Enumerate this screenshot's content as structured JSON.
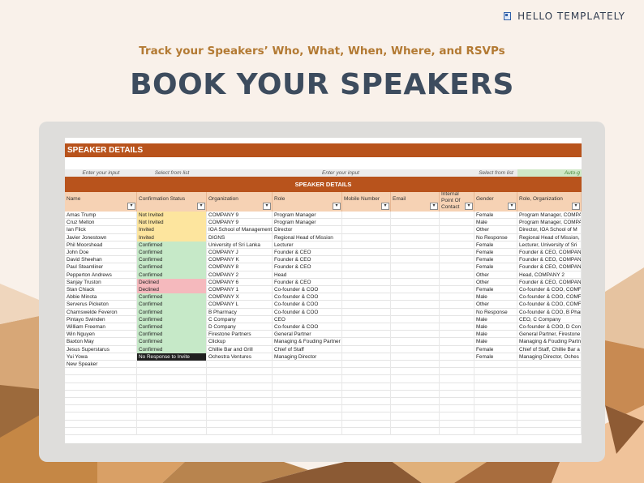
{
  "brand": {
    "name": "HELLO TEMPLATELY",
    "icon": "notebook-icon"
  },
  "tagline": "Track your Speakers’ Who, What, When, Where, and RSVPs",
  "headline": "BOOK YOUR SPEAKERS",
  "sheet": {
    "title": "SPEAKER DETAILS",
    "band_title": "SPEAKER DETAILS",
    "hints": {
      "name": "Enter your input",
      "status": "Select from list",
      "org_to_point": "Enter your input",
      "gender": "Select from list",
      "auto": "Auto-g"
    },
    "columns": [
      {
        "label": "Name"
      },
      {
        "label": "Confirmation Status"
      },
      {
        "label": "Organization"
      },
      {
        "label": "Role"
      },
      {
        "label": "Mobile Number"
      },
      {
        "label": "Email"
      },
      {
        "label": "Internal Point Of Contact"
      },
      {
        "label": "Gender"
      },
      {
        "label": "Role, Organization"
      }
    ],
    "dropdown_glyph": "▾",
    "rows": [
      {
        "name": "Amas Trump",
        "status": "Not Invited",
        "org": "COMPANY 9",
        "role": "Program Manager",
        "gender": "Female",
        "ro": "Program Manager, COMPA"
      },
      {
        "name": "Cruz Melton",
        "status": "Not Invited",
        "org": "COMPANY 9",
        "role": "Program Manager",
        "gender": "Male",
        "ro": "Program Manager, COMPA"
      },
      {
        "name": "Ian Flick",
        "status": "Invited",
        "org": "IOA School of Management",
        "role": "Director",
        "gender": "Other",
        "ro": "Director, IOA School of M"
      },
      {
        "name": "Javier Jonestown",
        "status": "Invited",
        "org": "DIGNS",
        "role": "Regional Head of Mission",
        "gender": "No Response",
        "ro": "Regional Head of Mission,"
      },
      {
        "name": "Phil Moorshead",
        "status": "Confirmed",
        "org": "University of Sri Lanka",
        "role": "Lecturer",
        "gender": "Female",
        "ro": "Lecturer, University of Sri"
      },
      {
        "name": "John Doe",
        "status": "Confirmed",
        "org": "COMPANY J",
        "role": "Founder & CEO",
        "gender": "Female",
        "ro": "Founder & CEO, COMPAN"
      },
      {
        "name": "David Sheehan",
        "status": "Confirmed",
        "org": "COMPANY K",
        "role": "Founder & CEO",
        "gender": "Female",
        "ro": "Founder & CEO, COMPAN"
      },
      {
        "name": "Paul Steamliner",
        "status": "Confirmed",
        "org": "COMPANY 8",
        "role": "Founder & CEO",
        "gender": "Female",
        "ro": "Founder & CEO, COMPAN"
      },
      {
        "name": "Pepperton Andrews",
        "status": "Confirmed",
        "org": "COMPANY 2",
        "role": "Head",
        "gender": "Other",
        "ro": "Head, COMPANY 2"
      },
      {
        "name": "Sanjay Truston",
        "status": "Declined",
        "org": "COMPANY 6",
        "role": "Founder & CEO",
        "gender": "Other",
        "ro": "Founder & CEO, COMPAN"
      },
      {
        "name": "Stan Chiack",
        "status": "Declined",
        "org": "COMPANY 1",
        "role": "Co-founder & COO",
        "gender": "Female",
        "ro": "Co-founder & COO, COMF"
      },
      {
        "name": "Abbie Minota",
        "status": "Confirmed",
        "org": "COMPANY X",
        "role": "Co-founder & COO",
        "gender": "Male",
        "ro": "Co-founder & COO, COMF"
      },
      {
        "name": "Serverus Picketon",
        "status": "Confirmed",
        "org": "COMPANY L",
        "role": "Co-founder & COO",
        "gender": "Other",
        "ro": "Co-founder & COO, COMF"
      },
      {
        "name": "Charnswelde Feveron",
        "status": "Confirmed",
        "org": "B Pharmacy",
        "role": "Co-founder & COO",
        "gender": "No Response",
        "ro": "Co-founder & COO, B Phar"
      },
      {
        "name": "Pintayo Swinden",
        "status": "Confirmed",
        "org": "C Company",
        "role": "CEO",
        "gender": "Male",
        "ro": "CEO, C Company"
      },
      {
        "name": "William Freeman",
        "status": "Confirmed",
        "org": "D Company",
        "role": "Co-founder & COO",
        "gender": "Male",
        "ro": "Co-founder & COO, D Con"
      },
      {
        "name": "Win Nguyen",
        "status": "Confirmed",
        "org": "Firestone Partners",
        "role": "General Partner",
        "gender": "Male",
        "ro": "General Partner, Firestone"
      },
      {
        "name": "Baxton May",
        "status": "Confirmed",
        "org": "Clickup",
        "role": "Managing & Fouding Partner",
        "gender": "Male",
        "ro": "Managing & Fouding Partn"
      },
      {
        "name": "Jesus Superstarus",
        "status": "Confirmed",
        "org": "Chillie Bar and Grill",
        "role": "Chief of Staff",
        "gender": "Female",
        "ro": "Chief of Staff, Chillie Bar a"
      },
      {
        "name": "Yui Yowa",
        "status": "No Response to Invite",
        "org": "Ochestra Ventures",
        "role": "Managing Director",
        "gender": "Female",
        "ro": "Managing Director, Oches"
      },
      {
        "name": "New Speaker",
        "status": "",
        "org": "",
        "role": "",
        "gender": "",
        "ro": ""
      },
      {
        "name": "",
        "status": "",
        "org": "",
        "role": "",
        "gender": "",
        "ro": ""
      },
      {
        "name": "",
        "status": "",
        "org": "",
        "role": "",
        "gender": "",
        "ro": ""
      },
      {
        "name": "",
        "status": "",
        "org": "",
        "role": "",
        "gender": "",
        "ro": ""
      },
      {
        "name": "",
        "status": "",
        "org": "",
        "role": "",
        "gender": "",
        "ro": ""
      },
      {
        "name": "",
        "status": "",
        "org": "",
        "role": "",
        "gender": "",
        "ro": ""
      },
      {
        "name": "",
        "status": "",
        "org": "",
        "role": "",
        "gender": "",
        "ro": ""
      },
      {
        "name": "",
        "status": "",
        "org": "",
        "role": "",
        "gender": "",
        "ro": ""
      },
      {
        "name": "",
        "status": "",
        "org": "",
        "role": "",
        "gender": "",
        "ro": ""
      },
      {
        "name": "",
        "status": "",
        "org": "",
        "role": "",
        "gender": "",
        "ro": ""
      }
    ]
  },
  "colors": {
    "accent": "#b8531c",
    "header_fill": "#f6d2b4",
    "confirmed": "#c6e9c8",
    "invited": "#fde59e",
    "declined": "#f5b9bd",
    "no_response": "#1f1f1f",
    "headline": "#3d4c5e",
    "tagline": "#b37a33"
  }
}
